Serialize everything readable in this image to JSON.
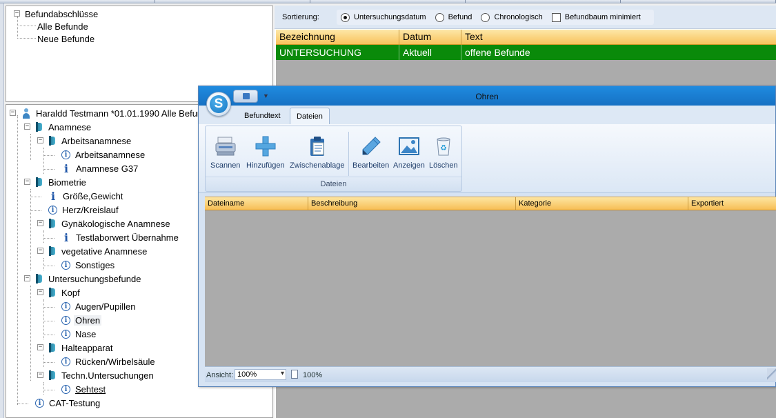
{
  "befund_tree": {
    "root": "Befundabschlüsse",
    "items": [
      "Alle Befunde",
      "Neue Befunde"
    ]
  },
  "patient_tree": {
    "patient": "Haraldd Testmann *01.01.1990 Alle Befunde",
    "nodes": {
      "anamnese": "Anamnese",
      "arbeitsanamnese_folder": "Arbeitsanamnese",
      "arbeitsanamnese": "Arbeitsanamnese",
      "anamnese_g37": "Anamnese G37",
      "biometrie": "Biometrie",
      "groesse": "Größe,Gewicht",
      "herz": "Herz/Kreislauf",
      "gyn": "Gynäkologische Anamnese",
      "testlabor": "Testlaborwert Übernahme",
      "vegetative": "vegetative Anamnese",
      "sonstiges": "Sonstiges",
      "untersuchungsbefunde": "Untersuchungsbefunde",
      "kopf": "Kopf",
      "augen": "Augen/Pupillen",
      "ohren": "Ohren",
      "nase": "Nase",
      "halteapparat": "Halteapparat",
      "ruecken": "Rücken/Wirbelsäule",
      "techn": "Techn.Untersuchungen",
      "sehtest": "Sehtest",
      "cat": "CAT-Testung"
    }
  },
  "sort_bar": {
    "label": "Sortierung:",
    "options": [
      "Untersuchungsdatum",
      "Befund",
      "Chronologisch"
    ],
    "selected": "Untersuchungsdatum",
    "checkbox_label": "Befundbaum minimiert",
    "checkbox_checked": false
  },
  "findings_grid": {
    "columns": [
      "Bezeichnung",
      "Datum",
      "Text"
    ],
    "rows": [
      {
        "bezeichnung": "UNTERSUCHUNG",
        "datum": "Aktuell",
        "text": "offene Befunde"
      }
    ],
    "row_color": "#0a8a0a",
    "header_color": "#f8c35c"
  },
  "dialog": {
    "title": "Ohren",
    "app_orb_letter": "S",
    "tabs": [
      "Befundtext",
      "Dateien"
    ],
    "active_tab": "Dateien",
    "ribbon": {
      "group_label": "Dateien",
      "buttons": [
        "Scannen",
        "Hinzufügen",
        "Zwischenablage",
        "Bearbeiten",
        "Anzeigen",
        "Löschen"
      ]
    },
    "file_grid": {
      "columns": [
        "Dateiname",
        "Beschreibung",
        "Kategorie",
        "Exportiert"
      ]
    },
    "status": {
      "ansicht_label": "Ansicht:",
      "zoom_select": "100%",
      "zoom_value": "100%"
    }
  }
}
